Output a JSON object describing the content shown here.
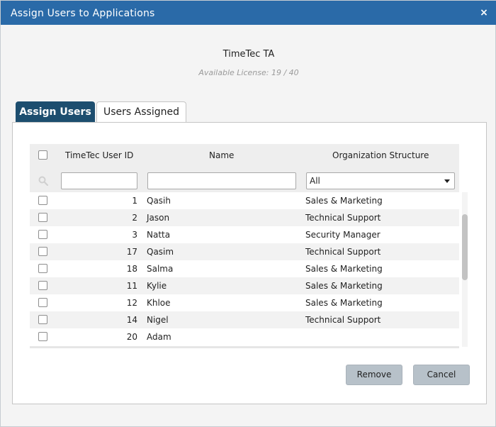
{
  "dialog": {
    "title": "Assign Users to Applications",
    "close_glyph": "×"
  },
  "app": {
    "name": "TimeTec TA",
    "license": "Available License: 19 / 40"
  },
  "tabs": [
    {
      "label": "Assign Users",
      "active": true
    },
    {
      "label": "Users Assigned",
      "active": false
    }
  ],
  "table": {
    "headers": {
      "user_id": "TimeTec User ID",
      "name": "Name",
      "org": "Organization Structure"
    },
    "filters": {
      "user_id": "",
      "name": "",
      "org_selected": "All"
    },
    "rows": [
      {
        "id": "1",
        "name": "Qasih",
        "org": "Sales & Marketing"
      },
      {
        "id": "2",
        "name": "Jason",
        "org": "Technical Support"
      },
      {
        "id": "3",
        "name": "Natta",
        "org": "Security Manager"
      },
      {
        "id": "17",
        "name": "Qasim",
        "org": "Technical Support"
      },
      {
        "id": "18",
        "name": "Salma",
        "org": "Sales & Marketing"
      },
      {
        "id": "11",
        "name": "Kylie",
        "org": "Sales & Marketing"
      },
      {
        "id": "12",
        "name": "Khloe",
        "org": "Sales & Marketing"
      },
      {
        "id": "14",
        "name": "Nigel",
        "org": "Technical Support"
      },
      {
        "id": "20",
        "name": "Adam",
        "org": ""
      }
    ]
  },
  "buttons": {
    "remove": "Remove",
    "cancel": "Cancel"
  },
  "colors": {
    "titlebar": "#2a6aa8",
    "active_tab": "#1d4e6f",
    "button": "#b7c1c9"
  }
}
